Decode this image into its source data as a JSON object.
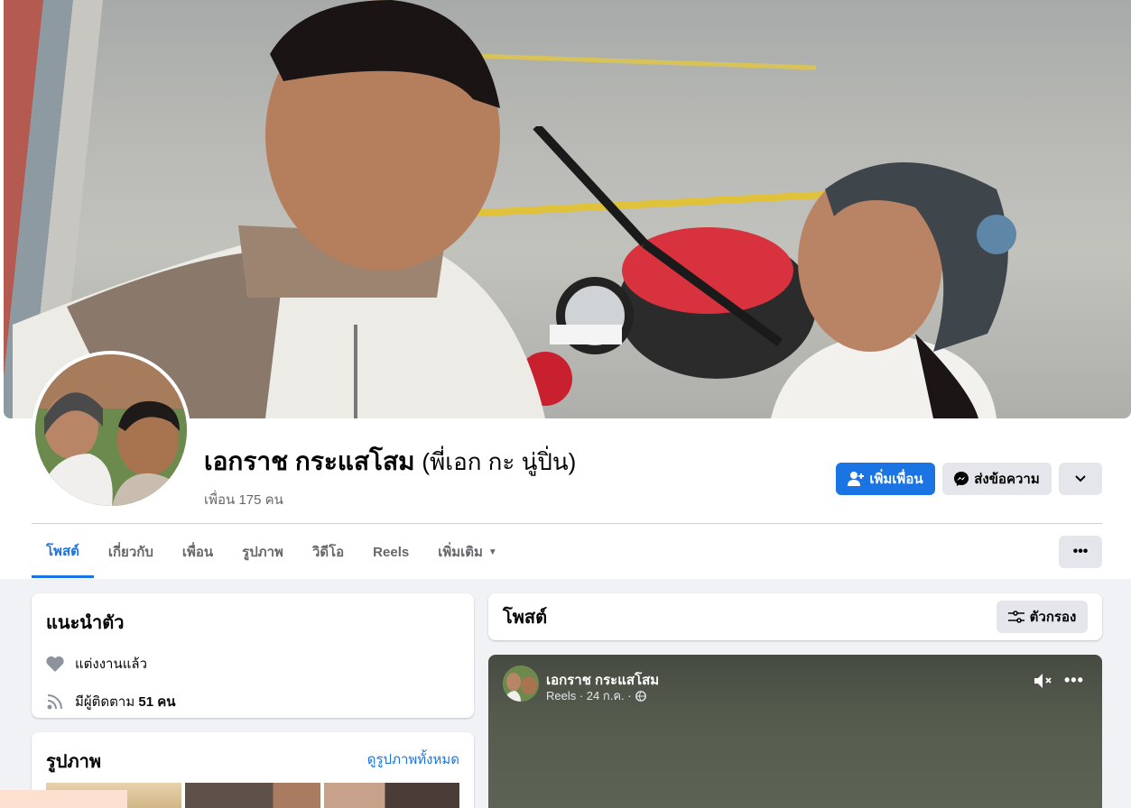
{
  "profile": {
    "name": "เอกราช กระแสโสม",
    "alternate_name": "(พี่เอก กะ นู่ปิ่น)",
    "friends_count": "เพื่อน 175 คน"
  },
  "actions": {
    "add_friend": "เพิ่มเพื่อน",
    "message": "ส่งข้อความ"
  },
  "tabs": [
    {
      "label": "โพสต์",
      "active": true
    },
    {
      "label": "เกี่ยวกับ",
      "active": false
    },
    {
      "label": "เพื่อน",
      "active": false
    },
    {
      "label": "รูปภาพ",
      "active": false
    },
    {
      "label": "วิดีโอ",
      "active": false
    },
    {
      "label": "Reels",
      "active": false
    },
    {
      "label": "เพิ่มเติม",
      "active": false
    }
  ],
  "intro": {
    "title": "แนะนำตัว",
    "relationship": "แต่งงานแล้ว",
    "followers_prefix": "มีผู้ติดตาม ",
    "followers_count": "51 คน"
  },
  "photos": {
    "title": "รูปภาพ",
    "see_all": "ดูรูปภาพทั้งหมด"
  },
  "posts": {
    "title": "โพสต์",
    "filter": "ตัวกรอง"
  },
  "reel_post": {
    "author": "เอกราช กระแสโสม",
    "meta": "Reels · 24 ก.ค. ·"
  },
  "icons": [
    "add-friend-icon",
    "messenger-icon",
    "chevron-down-icon",
    "more-icon",
    "heart-icon",
    "rss-icon",
    "filter-icon",
    "globe-icon",
    "mute-icon"
  ],
  "colors": {
    "accent": "#1b74e4",
    "background": "#f0f2f5",
    "secondary_button": "#e4e6eb"
  }
}
